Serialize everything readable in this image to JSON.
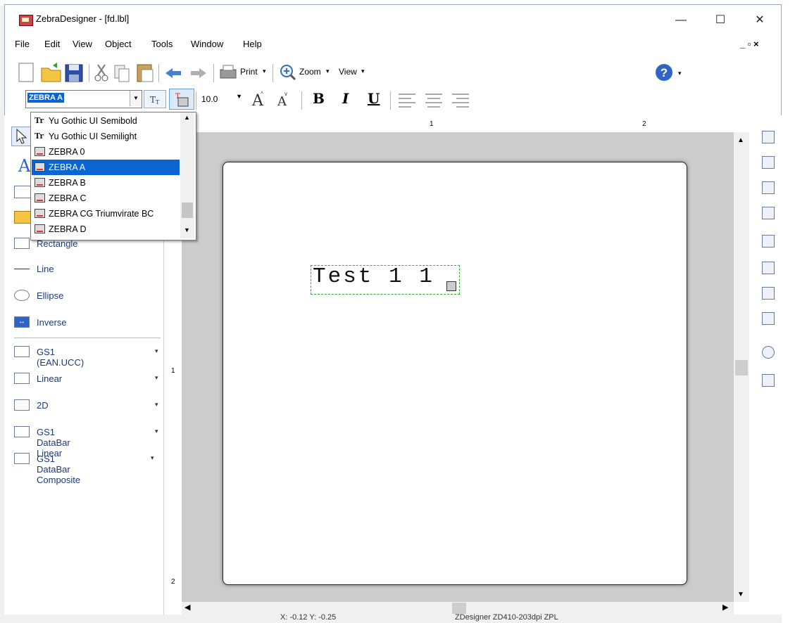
{
  "window": {
    "title": "ZebraDesigner - [fd.lbl]",
    "minimize": "—",
    "maximize": "☐",
    "close": "✕"
  },
  "menubar": {
    "items": [
      "File",
      "Edit",
      "View",
      "Object",
      "Tools",
      "Window",
      "Help"
    ],
    "mdi_controls": "_ ▫ ×"
  },
  "toolbar": {
    "print_label": "Print",
    "zoom_label": "Zoom",
    "view_label": "View"
  },
  "format_bar": {
    "font_value": "ZEBRA A",
    "size_value": "10.0",
    "bold": "B",
    "italic": "I",
    "underline": "U"
  },
  "font_list": {
    "items": [
      {
        "label": "Yu Gothic UI Semibold",
        "icon": "truetype-icon"
      },
      {
        "label": "Yu Gothic UI Semilight",
        "icon": "truetype-icon"
      },
      {
        "label": "ZEBRA 0",
        "icon": "printer-font-icon"
      },
      {
        "label": "ZEBRA A",
        "icon": "printer-font-icon",
        "selected": true
      },
      {
        "label": "ZEBRA B",
        "icon": "printer-font-icon"
      },
      {
        "label": "ZEBRA C",
        "icon": "printer-font-icon"
      },
      {
        "label": "ZEBRA CG Triumvirate BC",
        "icon": "printer-font-icon"
      },
      {
        "label": "ZEBRA D",
        "icon": "printer-font-icon"
      }
    ]
  },
  "tools": {
    "rectangle": "Rectangle",
    "line": "Line",
    "ellipse": "Ellipse",
    "inverse": "Inverse",
    "gs1": "GS1 (EAN.UCC)",
    "linear": "Linear",
    "twod": "2D",
    "gs1_databar_linear": "GS1 DataBar Linear",
    "gs1_databar_composite": "GS1 DataBar Composite"
  },
  "ruler": {
    "h_marks": [
      "1",
      "2"
    ],
    "v_marks": [
      "1",
      "2"
    ]
  },
  "canvas": {
    "text_object": "Test 1 1"
  },
  "statusbar": {
    "position": "X: -0.12 Y: -0.25",
    "printer": "ZDesigner ZD410-203dpi ZPL"
  }
}
